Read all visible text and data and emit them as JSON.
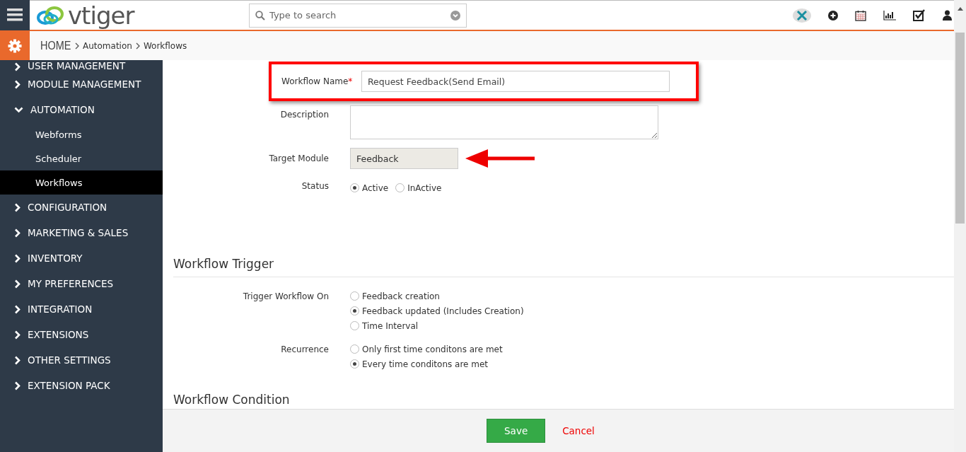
{
  "header": {
    "logo": "vtiger",
    "search": {
      "placeholder": "Type to search"
    }
  },
  "breadcrumb": [
    "HOME",
    "Automation",
    "Workflows"
  ],
  "sidebar": {
    "items": [
      {
        "label": "USER MANAGEMENT",
        "expanded": false
      },
      {
        "label": "MODULE MANAGEMENT",
        "expanded": false
      },
      {
        "label": "AUTOMATION",
        "expanded": true,
        "children": [
          {
            "label": "Webforms",
            "selected": false
          },
          {
            "label": "Scheduler",
            "selected": false
          },
          {
            "label": "Workflows",
            "selected": true
          }
        ]
      },
      {
        "label": "CONFIGURATION",
        "expanded": false
      },
      {
        "label": "MARKETING & SALES",
        "expanded": false
      },
      {
        "label": "INVENTORY",
        "expanded": false
      },
      {
        "label": "MY PREFERENCES",
        "expanded": false
      },
      {
        "label": "INTEGRATION",
        "expanded": false
      },
      {
        "label": "EXTENSIONS",
        "expanded": false
      },
      {
        "label": "OTHER SETTINGS",
        "expanded": false
      },
      {
        "label": "EXTENSION PACK",
        "expanded": false
      }
    ]
  },
  "form": {
    "workflow_name": {
      "label": "Workflow Name",
      "required": "*",
      "value": "Request Feedback(Send Email)"
    },
    "description": {
      "label": "Description"
    },
    "target_module": {
      "label": "Target Module",
      "value": "Feedback"
    },
    "status": {
      "label": "Status",
      "options": [
        {
          "label": "Active",
          "selected": true
        },
        {
          "label": "InActive",
          "selected": false
        }
      ]
    }
  },
  "trigger": {
    "title": "Workflow Trigger",
    "trigger_on": {
      "label": "Trigger Workflow On",
      "options": [
        {
          "label": "Feedback creation",
          "selected": false
        },
        {
          "label": "Feedback updated  (Includes Creation)",
          "selected": true
        },
        {
          "label": "Time Interval",
          "selected": false
        }
      ]
    },
    "recurrence": {
      "label": "Recurrence",
      "options": [
        {
          "label": "Only first time conditons are met",
          "selected": false
        },
        {
          "label": "Every time conditons are met",
          "selected": true
        }
      ]
    }
  },
  "condition": {
    "title": "Workflow Condition"
  },
  "footer": {
    "save": "Save",
    "cancel": "Cancel"
  }
}
